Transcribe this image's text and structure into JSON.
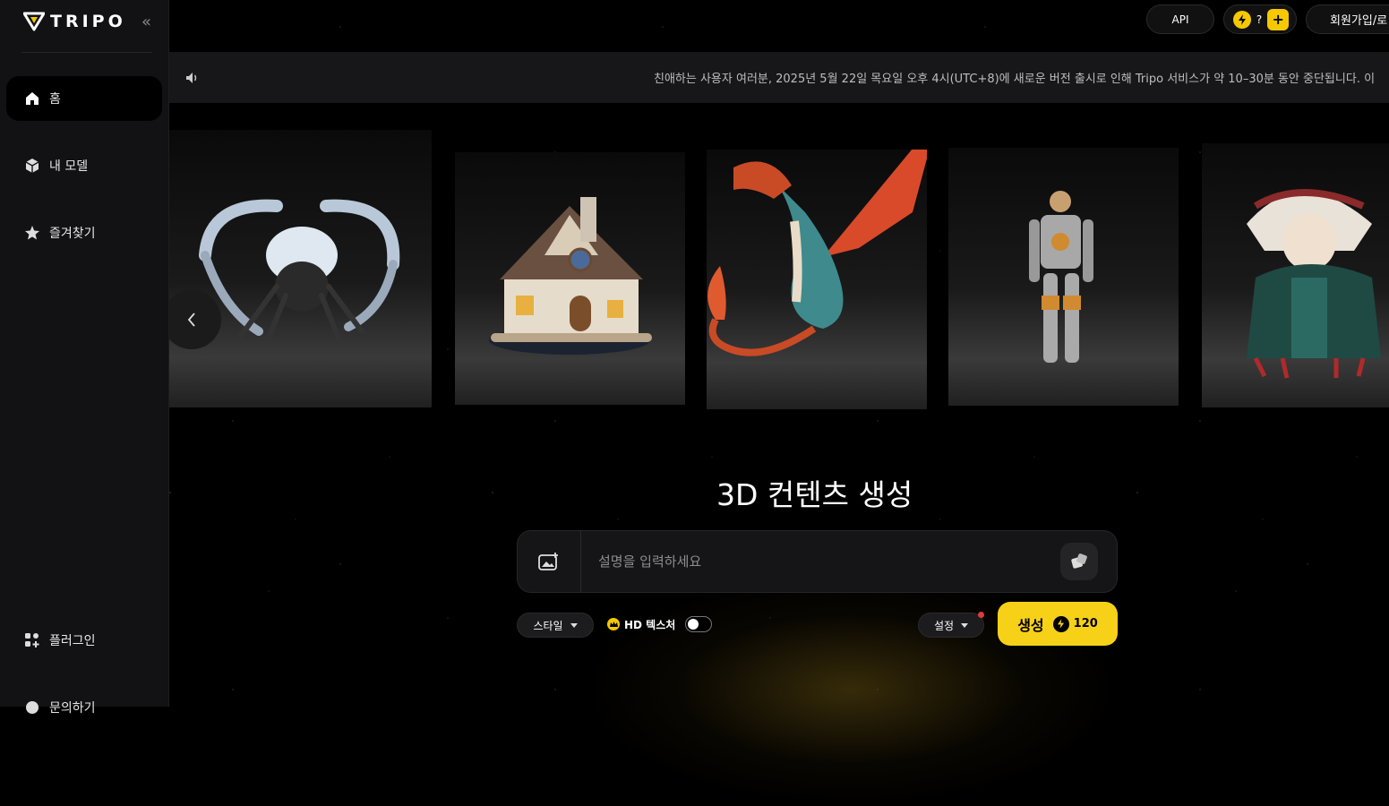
{
  "brand": {
    "name": "TRIPO",
    "collapse_icon": "«"
  },
  "sidebar": {
    "items": [
      {
        "label": "홈",
        "icon": "home-icon",
        "active": true
      },
      {
        "label": "내 모델",
        "icon": "cube-icon"
      },
      {
        "label": "즐겨찾기",
        "icon": "star-icon"
      }
    ],
    "bottom_items": [
      {
        "label": "플러그인",
        "icon": "plugin-icon"
      },
      {
        "label": "문의하기",
        "icon": "chat-icon"
      }
    ]
  },
  "topbar": {
    "api_label": "API",
    "credits_value": "?",
    "plus_label": "+",
    "signup_label": "회원가입/로"
  },
  "announcement": {
    "text": "친애하는 사용자 여러분, 2025년 5월 22일 목요일 오후 4시(UTC+8)에 새로운 버전 출시로 인해 Tripo 서비스가 약 10–30분 동안 중단됩니다. 이"
  },
  "carousel": {
    "prev_icon": "chevron-left-icon",
    "cards": [
      "spider-creature-model",
      "cottage-model",
      "dragon-model",
      "robot-model",
      "warrior-doll-model"
    ]
  },
  "generate": {
    "title": "3D 컨텐츠 생성",
    "placeholder": "설명을 입력하세요",
    "style_label": "스타일",
    "hd_label": "HD 텍스처",
    "settings_label": "설정",
    "generate_label": "생성",
    "cost": "120"
  },
  "colors": {
    "accent": "#f7d117",
    "sidebar_bg": "#121214",
    "notice_dot": "#e03a3a"
  }
}
